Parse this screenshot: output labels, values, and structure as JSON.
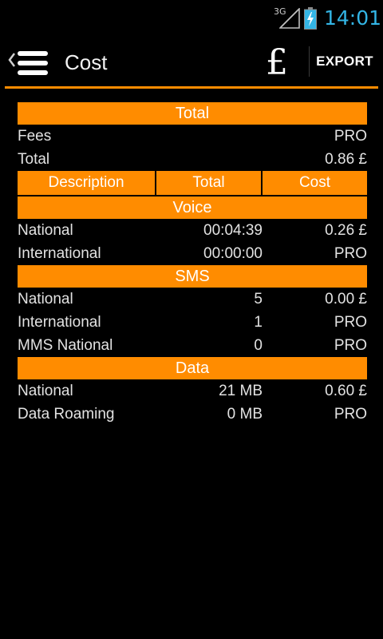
{
  "status_bar": {
    "network": "3G",
    "time": "14:01",
    "icons": [
      "signal-icon",
      "battery-charging-icon"
    ]
  },
  "action_bar": {
    "title": "Cost",
    "currency_symbol": "£",
    "export_label": "EXPORT",
    "accent_color": "#ff8c00"
  },
  "summary": {
    "header": "Total",
    "rows": [
      {
        "label": "Fees",
        "value": "PRO"
      },
      {
        "label": "Total",
        "value": "0.86 £"
      }
    ]
  },
  "columns": [
    "Description",
    "Total",
    "Cost"
  ],
  "sections": [
    {
      "title": "Voice",
      "rows": [
        {
          "description": "National",
          "total": "00:04:39",
          "cost": "0.26 £"
        },
        {
          "description": "International",
          "total": "00:00:00",
          "cost": "PRO"
        }
      ]
    },
    {
      "title": "SMS",
      "rows": [
        {
          "description": "National",
          "total": "5",
          "cost": "0.00 £"
        },
        {
          "description": "International",
          "total": "1",
          "cost": "PRO"
        },
        {
          "description": "MMS National",
          "total": "0",
          "cost": "PRO"
        }
      ]
    },
    {
      "title": "Data",
      "rows": [
        {
          "description": "National",
          "total": "21 MB",
          "cost": "0.60 £"
        },
        {
          "description": "Data Roaming",
          "total": "0 MB",
          "cost": "PRO"
        }
      ]
    }
  ]
}
